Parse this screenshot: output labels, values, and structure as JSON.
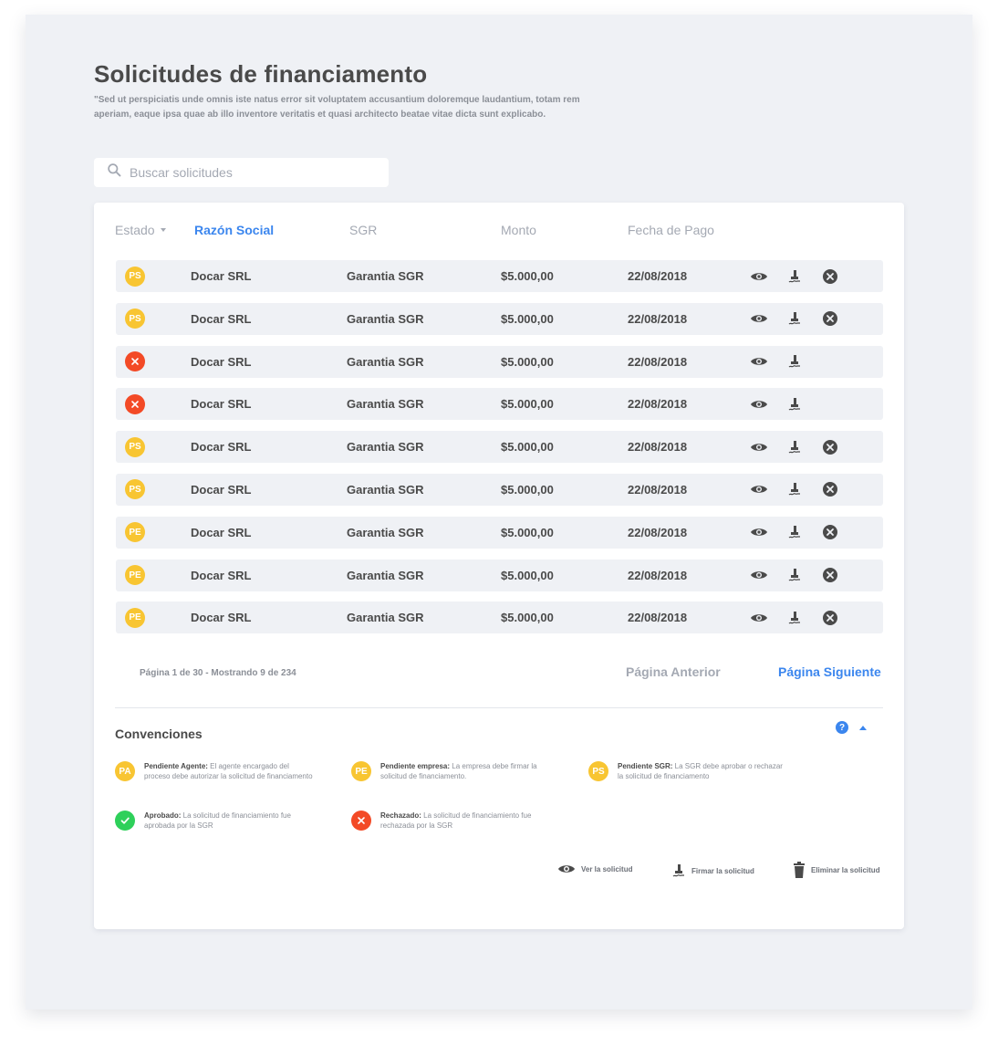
{
  "page": {
    "title": "Solicitudes de financiamento",
    "description": "\"Sed ut perspiciatis unde omnis iste natus error sit voluptatem accusantium doloremque laudantium, totam rem aperiam, eaque ipsa quae ab illo inventore veritatis et quasi architecto beatae vitae dicta sunt explicabo."
  },
  "search": {
    "placeholder": "Buscar solicitudes"
  },
  "table": {
    "headers": {
      "estado": "Estado",
      "razon_social": "Razón Social",
      "sgr": "SGR",
      "monto": "Monto",
      "fecha": "Fecha de Pago"
    },
    "rows": [
      {
        "status": "PS",
        "status_color": "yellow",
        "razon": "Docar SRL",
        "sgr": "Garantia SGR",
        "monto": "$5.000,00",
        "fecha": "22/08/2018",
        "can_delete": true
      },
      {
        "status": "PS",
        "status_color": "yellow",
        "razon": "Docar SRL",
        "sgr": "Garantia SGR",
        "monto": "$5.000,00",
        "fecha": "22/08/2018",
        "can_delete": true
      },
      {
        "status": "",
        "status_color": "red",
        "razon": "Docar SRL",
        "sgr": "Garantia SGR",
        "monto": "$5.000,00",
        "fecha": "22/08/2018",
        "can_delete": false
      },
      {
        "status": "",
        "status_color": "red",
        "razon": "Docar SRL",
        "sgr": "Garantia SGR",
        "monto": "$5.000,00",
        "fecha": "22/08/2018",
        "can_delete": false
      },
      {
        "status": "PS",
        "status_color": "yellow",
        "razon": "Docar SRL",
        "sgr": "Garantia SGR",
        "monto": "$5.000,00",
        "fecha": "22/08/2018",
        "can_delete": true
      },
      {
        "status": "PS",
        "status_color": "yellow",
        "razon": "Docar SRL",
        "sgr": "Garantia SGR",
        "monto": "$5.000,00",
        "fecha": "22/08/2018",
        "can_delete": true
      },
      {
        "status": "PE",
        "status_color": "yellow",
        "razon": "Docar SRL",
        "sgr": "Garantia SGR",
        "monto": "$5.000,00",
        "fecha": "22/08/2018",
        "can_delete": true
      },
      {
        "status": "PE",
        "status_color": "yellow",
        "razon": "Docar SRL",
        "sgr": "Garantia SGR",
        "monto": "$5.000,00",
        "fecha": "22/08/2018",
        "can_delete": true
      },
      {
        "status": "PE",
        "status_color": "yellow",
        "razon": "Docar SRL",
        "sgr": "Garantia SGR",
        "monto": "$5.000,00",
        "fecha": "22/08/2018",
        "can_delete": true
      }
    ]
  },
  "pagination": {
    "info": "Página 1 de 30 - Mostrando 9 de 234",
    "prev": "Página Anterior",
    "next": "Página Siguiente"
  },
  "conventions": {
    "title": "Convenciones",
    "help": "?",
    "items": [
      {
        "badge": "PA",
        "color": "yellow",
        "label": "Pendiente Agente:",
        "text": " El agente encargado del proceso debe autorizar la solicitud de financiamento"
      },
      {
        "badge": "PE",
        "color": "yellow",
        "label": "Pendiente empresa:",
        "text": " La empresa debe firmar la solicitud de financiamento."
      },
      {
        "badge": "PS",
        "color": "yellow",
        "label": "Pendiente SGR:",
        "text": " La SGR debe aprobar o rechazar la solicitud de financiamento"
      },
      {
        "badge": "",
        "color": "green",
        "label": "Aprobado:",
        "text": " La solicitud de financiamiento fue aprobada por la SGR"
      },
      {
        "badge": "",
        "color": "red",
        "label": "Rechazado:",
        "text": " La solicitud de financiamiento fue rechazada por la SGR"
      }
    ],
    "legend": {
      "view": "Ver la solicitud",
      "sign": "Firmar la solicitud",
      "delete": "Eliminar la solicitud"
    }
  },
  "icons": {
    "search": "search-icon",
    "view": "eye-icon",
    "sign": "pen-hand-icon",
    "delete": "close-circle-icon",
    "trash": "trash-icon"
  },
  "colors": {
    "accent": "#3b86ee",
    "pending": "#f8c532",
    "rejected": "#f34a26",
    "approved": "#2ed05a",
    "background": "#eff1f5"
  }
}
